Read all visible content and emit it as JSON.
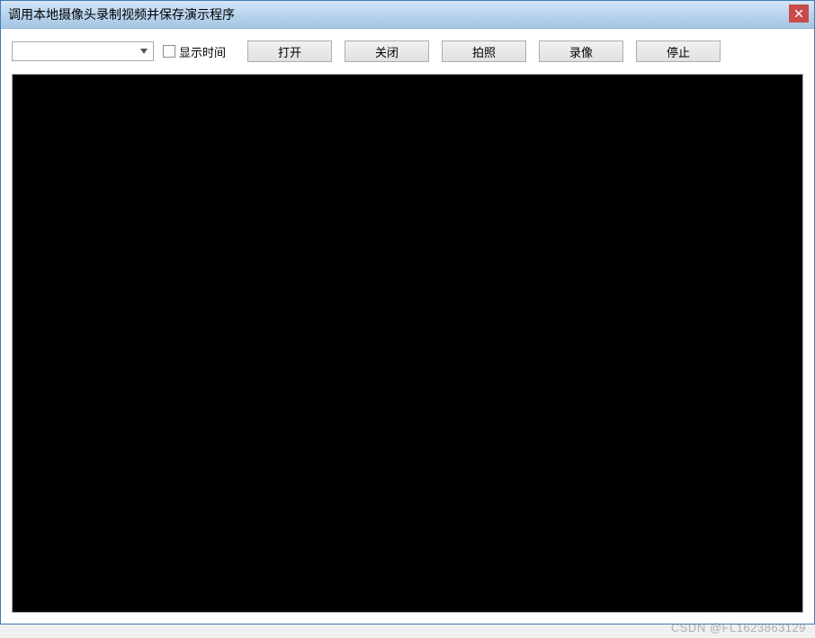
{
  "window": {
    "title": "调用本地摄像头录制视频并保存演示程序"
  },
  "toolbar": {
    "combo_value": "",
    "checkbox_label": "显示时间",
    "buttons": {
      "open": "打开",
      "close": "关闭",
      "capture": "拍照",
      "record": "录像",
      "stop": "停止"
    }
  },
  "watermark": "CSDN @FL1623863129"
}
